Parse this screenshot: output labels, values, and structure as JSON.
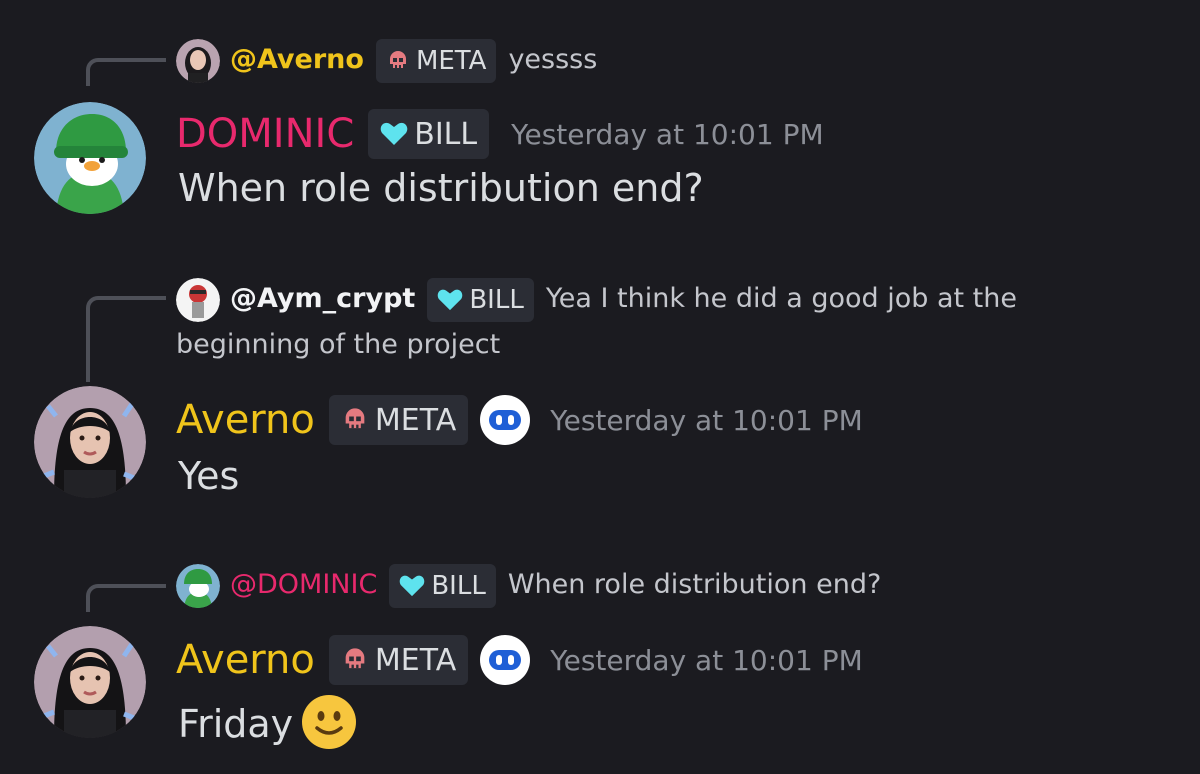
{
  "colors": {
    "background": "#1b1b20",
    "dominic_name": "#e8296d",
    "averno_name": "#f0c41b",
    "timestamp": "#8c8f97",
    "tag_bg": "#2b2d35"
  },
  "messages": [
    {
      "reply": {
        "author": "@Averno",
        "tag": "META",
        "tag_icon": "skull-icon",
        "text": "yessss"
      },
      "author": "DOMINIC",
      "tag": "BILL",
      "tag_icon": "heart-icon",
      "timestamp": "Yesterday at 10:01 PM",
      "text": "When role distribution end?"
    },
    {
      "reply": {
        "author": "@Aym_crypt",
        "tag": "BILL",
        "tag_icon": "heart-icon",
        "text_line1": "Yea I think he did a good job at the",
        "text_line2": "beginning of the project"
      },
      "author": "Averno",
      "tag": "META",
      "tag_icon": "skull-icon",
      "badge_icon": "robot-face-icon",
      "timestamp": "Yesterday at 10:01 PM",
      "text": "Yes"
    },
    {
      "reply": {
        "author": "@DOMINIC",
        "tag": "BILL",
        "tag_icon": "heart-icon",
        "text": "When role distribution end?"
      },
      "author": "Averno",
      "tag": "META",
      "tag_icon": "skull-icon",
      "badge_icon": "robot-face-icon",
      "timestamp": "Yesterday at 10:01 PM",
      "text": "Friday",
      "emoji": "slightly-smiling-face-icon"
    }
  ]
}
